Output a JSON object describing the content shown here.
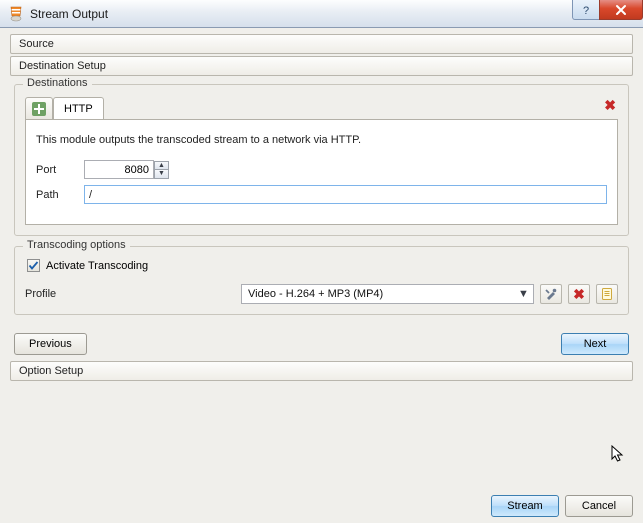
{
  "window": {
    "title": "Stream Output"
  },
  "sections": {
    "source": "Source",
    "dest_setup": "Destination Setup",
    "option_setup": "Option Setup"
  },
  "destinations": {
    "group_title": "Destinations",
    "tabs": {
      "active": "HTTP"
    },
    "description": "This module outputs the transcoded stream to a network via HTTP.",
    "port_label": "Port",
    "port_value": "8080",
    "path_label": "Path",
    "path_value": "/"
  },
  "transcoding": {
    "group_title": "Transcoding options",
    "activate_label": "Activate Transcoding",
    "activate_checked": true,
    "profile_label": "Profile",
    "profile_value": "Video - H.264 + MP3 (MP4)"
  },
  "nav": {
    "previous": "Previous",
    "next": "Next"
  },
  "footer": {
    "stream": "Stream",
    "cancel": "Cancel"
  }
}
